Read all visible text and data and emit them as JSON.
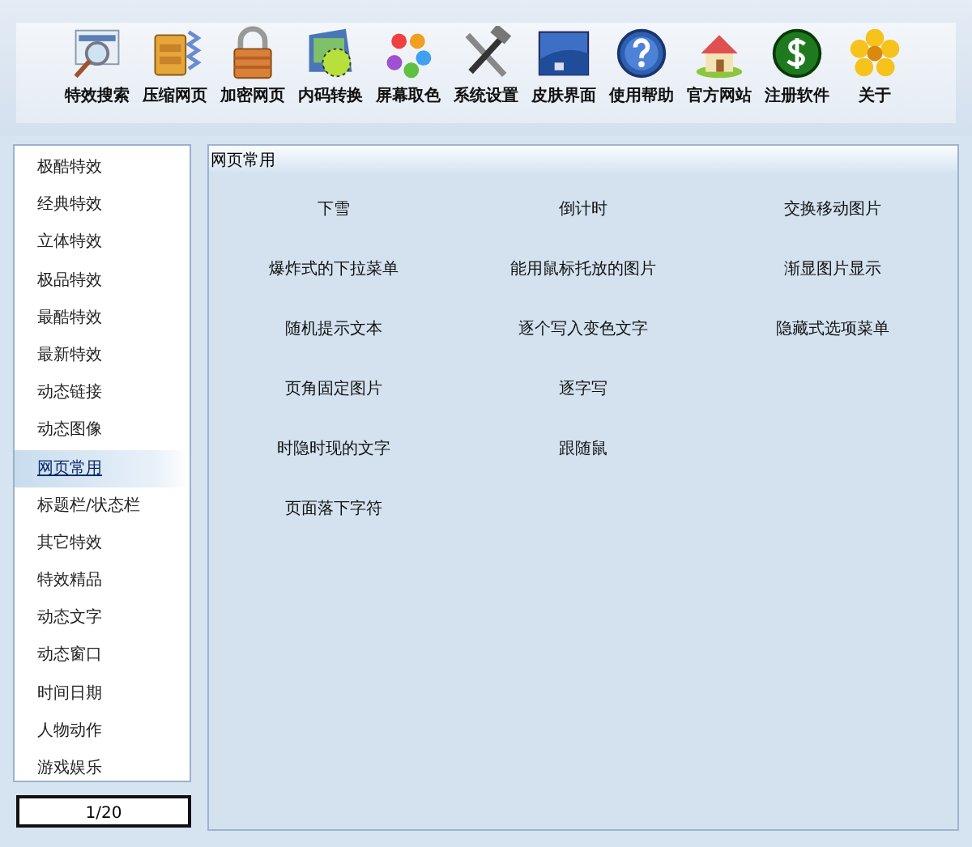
{
  "toolbar": [
    {
      "label": "特效搜索"
    },
    {
      "label": "压缩网页"
    },
    {
      "label": "加密网页"
    },
    {
      "label": "内码转换"
    },
    {
      "label": "屏幕取色"
    },
    {
      "label": "系统设置"
    },
    {
      "label": "皮肤界面"
    },
    {
      "label": "使用帮助"
    },
    {
      "label": "官方网站"
    },
    {
      "label": "注册软件"
    },
    {
      "label": "关于"
    }
  ],
  "sidebar": {
    "items": [
      {
        "label": "极酷特效",
        "selected": false
      },
      {
        "label": "经典特效",
        "selected": false
      },
      {
        "label": "立体特效",
        "selected": false
      },
      {
        "label": "极品特效",
        "selected": false
      },
      {
        "label": "最酷特效",
        "selected": false
      },
      {
        "label": "最新特效",
        "selected": false
      },
      {
        "label": "动态链接",
        "selected": false
      },
      {
        "label": "动态图像",
        "selected": false
      },
      {
        "label": "网页常用",
        "selected": true
      },
      {
        "label": "标题栏/状态栏",
        "selected": false
      },
      {
        "label": "其它特效",
        "selected": false
      },
      {
        "label": "特效精品",
        "selected": false
      },
      {
        "label": "动态文字",
        "selected": false
      },
      {
        "label": "动态窗口",
        "selected": false
      },
      {
        "label": "时间日期",
        "selected": false
      },
      {
        "label": "人物动作",
        "selected": false
      },
      {
        "label": "游戏娱乐",
        "selected": false
      }
    ],
    "pager": "1/20"
  },
  "panel": {
    "title": "网页常用",
    "rows": [
      [
        "下雪",
        "倒计时",
        "交换移动图片"
      ],
      [
        "爆炸式的下拉菜单",
        "能用鼠标托放的图片",
        "渐显图片显示"
      ],
      [
        "随机提示文本",
        "逐个写入变色文字",
        "隐藏式选项菜单"
      ],
      [
        "页角固定图片",
        "逐字写"
      ],
      [
        "时隐时现的文字",
        "跟随鼠"
      ],
      [
        "页面落下字符"
      ]
    ]
  }
}
